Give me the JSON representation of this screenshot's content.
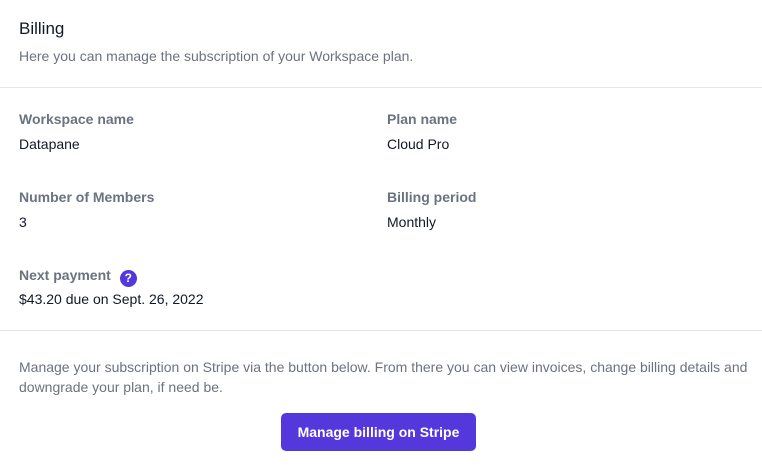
{
  "header": {
    "title": "Billing",
    "subtitle": "Here you can manage the subscription of your Workspace plan."
  },
  "fields": [
    {
      "label": "Workspace name",
      "value": "Datapane"
    },
    {
      "label": "Plan name",
      "value": "Cloud Pro"
    },
    {
      "label": "Number of Members",
      "value": "3"
    },
    {
      "label": "Billing period",
      "value": "Monthly"
    },
    {
      "label": "Next payment",
      "value": "$43.20 due on Sept. 26, 2022",
      "icon": "question-circle-icon",
      "icon_glyph": "?"
    }
  ],
  "footer": {
    "description": "Manage your subscription on Stripe via the button below. From there you can view invoices, change billing details and downgrade your plan, if need be.",
    "button_label": "Manage billing on Stripe"
  },
  "colors": {
    "accent": "#5438dc"
  }
}
